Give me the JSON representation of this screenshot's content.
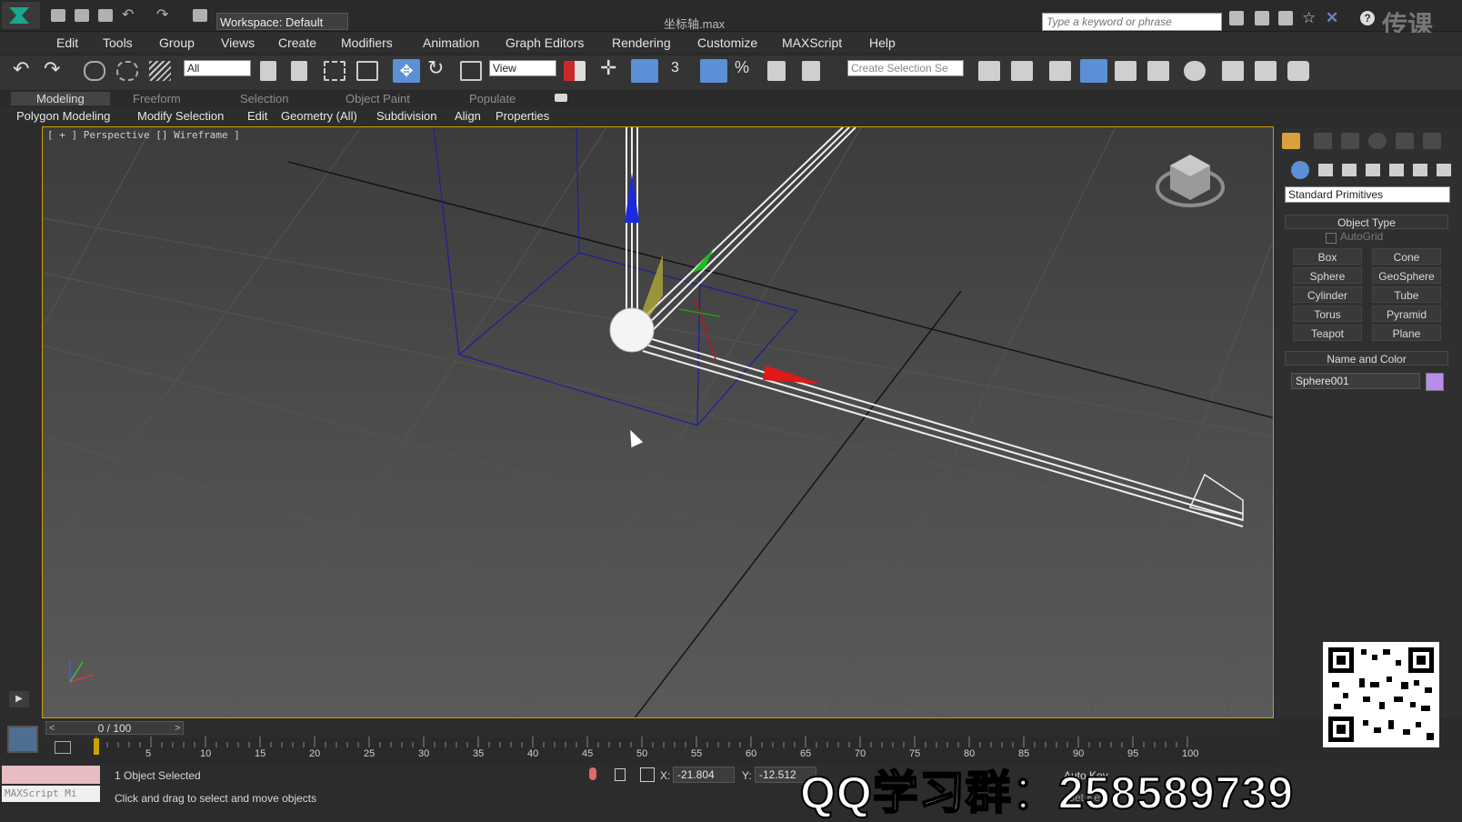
{
  "titlebar": {
    "workspace_label": "Workspace: Default",
    "window_title": "坐标轴.max",
    "search_placeholder": "Type a keyword or phrase",
    "watermark": "传课"
  },
  "menu": [
    "Edit",
    "Tools",
    "Group",
    "Views",
    "Create",
    "Modifiers",
    "Animation",
    "Graph Editors",
    "Rendering",
    "Customize",
    "MAXScript",
    "Help"
  ],
  "toolbar": {
    "selection_filter": "All",
    "ref_coord": "View",
    "snap_value": "3",
    "named_selection_placeholder": "Create Selection Se"
  },
  "ribbon": {
    "tabs": [
      "Modeling",
      "Freeform",
      "Selection",
      "Object Paint",
      "Populate"
    ],
    "items": [
      "Polygon Modeling",
      "Modify Selection",
      "Edit",
      "Geometry (All)",
      "Subdivision",
      "Align",
      "Properties"
    ]
  },
  "viewport": {
    "label": "[ + ] Perspective [] Wireframe ]",
    "axis_colors": {
      "x": "#e01818",
      "y": "#18c018",
      "z": "#1a2ae0"
    }
  },
  "command_panel": {
    "category": "Standard Primitives",
    "object_type_title": "Object Type",
    "autogrid_label": "AutoGrid",
    "buttons": [
      "Box",
      "Cone",
      "Sphere",
      "GeoSphere",
      "Cylinder",
      "Tube",
      "Torus",
      "Pyramid",
      "Teapot",
      "Plane"
    ],
    "name_color_title": "Name and Color",
    "object_name": "Sphere001",
    "object_color": "#b68ee8"
  },
  "timeline": {
    "slider_label": "0 / 100",
    "ticks": [
      "5",
      "10",
      "15",
      "20",
      "25",
      "30",
      "35",
      "40",
      "45",
      "50",
      "55",
      "60",
      "65",
      "70",
      "75",
      "80",
      "85",
      "90",
      "95",
      "100"
    ]
  },
  "status": {
    "selection_info": "1 Object Selected",
    "prompt": "Click and drag to select and move objects",
    "maxscript_label": "MAXScript Mi",
    "x_label": "X:",
    "x_value": "-21.804",
    "y_label": "Y:",
    "y_value": "-12.512",
    "auto_key": "Auto Key",
    "set_key": "Set Key"
  },
  "overlay": {
    "qq_text": "QQ学习群：258589739"
  }
}
